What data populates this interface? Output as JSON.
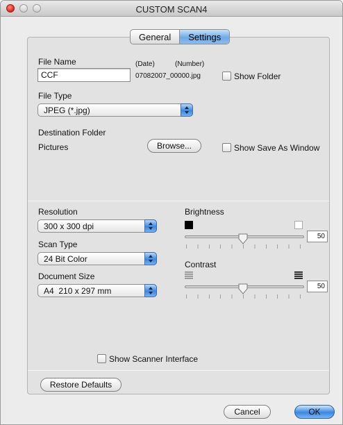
{
  "window": {
    "title": "CUSTOM SCAN4"
  },
  "tabs": {
    "general": "General",
    "settings": "Settings",
    "active": "Settings"
  },
  "file_name": {
    "label": "File Name",
    "date_caption": "(Date)",
    "number_caption": "(Number)",
    "value": "CCF",
    "suffix": "07082007_00000.jpg",
    "show_folder": {
      "label": "Show Folder",
      "checked": false
    }
  },
  "file_type": {
    "label": "File Type",
    "selected": "JPEG (*.jpg)"
  },
  "destination": {
    "label": "Destination Folder",
    "folder": "Pictures",
    "browse_label": "Browse...",
    "show_save_as": {
      "label": "Show Save As Window",
      "checked": false
    }
  },
  "resolution": {
    "label": "Resolution",
    "selected": "300 x 300 dpi"
  },
  "scan_type": {
    "label": "Scan Type",
    "selected": "24 Bit Color"
  },
  "document_size": {
    "label": "Document Size",
    "selected": "A4  210 x 297 mm"
  },
  "brightness": {
    "label": "Brightness",
    "value": "50",
    "low_icon": "black-square-icon",
    "high_icon": "white-square-icon"
  },
  "contrast": {
    "label": "Contrast",
    "value": "50",
    "low_icon": "low-contrast-icon",
    "high_icon": "high-contrast-icon"
  },
  "show_scanner_interface": {
    "label": "Show Scanner Interface",
    "checked": false
  },
  "buttons": {
    "restore_defaults": "Restore Defaults",
    "cancel": "Cancel",
    "ok": "OK"
  },
  "colors": {
    "accent": "#3b86e0",
    "panel": "#e2e2e2",
    "window": "#ececec"
  }
}
